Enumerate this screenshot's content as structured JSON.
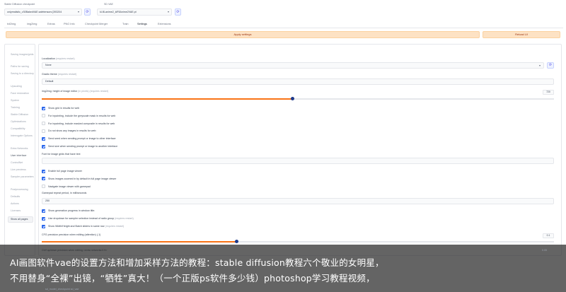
{
  "header": {
    "checkpoint_label": "Stable Diffusion checkpoint",
    "checkpoint_value": "onlyrealistic_v30BakedVAE.safetensors [393204",
    "vae_label": "SD VAE",
    "vae_value": "kl-f8-anime2_klF8Anime2VAE.pt"
  },
  "tabs": [
    "txt2img",
    "img2img",
    "Extras",
    "PNG Info",
    "Checkpoint Merger",
    "Train",
    "Settings",
    "Extensions"
  ],
  "buttons": {
    "apply": "Apply settings",
    "reload": "Reload UI"
  },
  "sidebar": {
    "items": [
      "Saving images/grids",
      "Paths for saving",
      "Saving to a directory",
      "Upscaling",
      "Face restoration",
      "System",
      "Training",
      "Stable Diffusion",
      "Optimizations",
      "Compatibility",
      "Interrogate Options",
      "Extra Networks",
      "User interface",
      "ControlNet",
      "Live previews",
      "Sampler parameters",
      "Postprocessing",
      "Defaults",
      "Actions",
      "Licenses"
    ],
    "show_all": "Show all pages"
  },
  "settings": {
    "localization_label": "Localization",
    "localization_hint": "(requires restart)",
    "localization_value": "None",
    "theme_label": "Gradio theme",
    "theme_hint": "(requires restart)",
    "theme_value": "Default",
    "img2img_height_label": "img2img: height of image editor",
    "img2img_height_hint": "(in pixels) (requires restart)",
    "img2img_height_value": "720",
    "img2img_height_fraction": 0.49,
    "checks_a": [
      {
        "text": "Show grid in results for web",
        "hint": "",
        "on": true
      },
      {
        "text": "For inpainting, include the greyscale mask in results for web",
        "hint": "",
        "on": false
      },
      {
        "text": "For inpainting, include masked composite in results for web",
        "hint": "",
        "on": false
      },
      {
        "text": "Do not show any images in results for web",
        "hint": "",
        "on": false
      },
      {
        "text": "Send seed when sending prompt or image to other interface",
        "hint": "",
        "on": true
      },
      {
        "text": "Send size when sending prompt or image to another interface",
        "hint": "",
        "on": true
      }
    ],
    "font_label": "Font for image grids that have text",
    "checks_b": [
      {
        "text": "Enable full page image viewer",
        "hint": "",
        "on": true
      },
      {
        "text": "Show images zoomed in by default in full page image viewer",
        "hint": "",
        "on": true
      },
      {
        "text": "Navigate image viewer with gamepad",
        "hint": "",
        "on": false
      }
    ],
    "gamepad_label": "Gamepad repeat period, in milliseconds",
    "gamepad_value": "250",
    "checks_c": [
      {
        "text": "Show generation progress in window title.",
        "hint": "",
        "on": true
      },
      {
        "text": "Use dropdown for sampler selection instead of radio group",
        "hint": "(requires restart)",
        "on": true
      },
      {
        "text": "Show Width/Height and Batch sliders in same row",
        "hint": "(requires restart)",
        "on": true
      }
    ],
    "cfg_label": "CFG precision precision when editing (attention) (-1)",
    "cfg_value": "0.1",
    "cfg_fraction": 0.38,
    "ghost_label": "Ctrl+up/down precision when editing <extra networks:0.9>",
    "ghost_value": "0.05",
    "ghost_bottom": "sd_model_checkpoint   sd_vae"
  },
  "overlay": {
    "line1": "AI画图软件vae的设置方法和增加采样方法的教程：stable diffusion教程六个敬业的女明星，",
    "line2": "不用替身“全裸”出镜，“牺牲”真大！（一个正版ps软件多少钱）photoshop学习教程视频，"
  },
  "colors": {
    "accent_orange": "#f97316",
    "apply_bg": "#fde2c4",
    "checkbox_blue": "#2563eb",
    "slider_knob": "#1e3a8a"
  }
}
